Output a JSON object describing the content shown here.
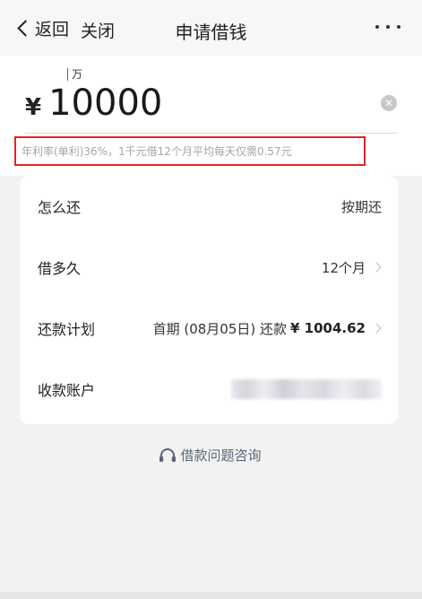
{
  "nav": {
    "back_label": "返回",
    "close_label": "关闭",
    "title": "申请借钱"
  },
  "amount": {
    "unit_hint": "万",
    "currency": "¥",
    "value": "10000",
    "clear_icon": "clear-icon"
  },
  "rate_note": "年利率(单利)36%，1千元借12个月平均每天仅需0.57元",
  "details": {
    "repay_method": {
      "label": "怎么还",
      "value": "按期还"
    },
    "term": {
      "label": "借多久",
      "value": "12个月"
    },
    "plan": {
      "label": "还款计划",
      "value_prefix": "首期 (08月05日) 还款",
      "amount": "¥ 1004.62"
    },
    "account": {
      "label": "收款账户"
    }
  },
  "consult": {
    "label": "借款问题咨询",
    "icon": "headset-icon"
  },
  "colors": {
    "highlight_border": "#e02424",
    "link": "#5a6577"
  }
}
